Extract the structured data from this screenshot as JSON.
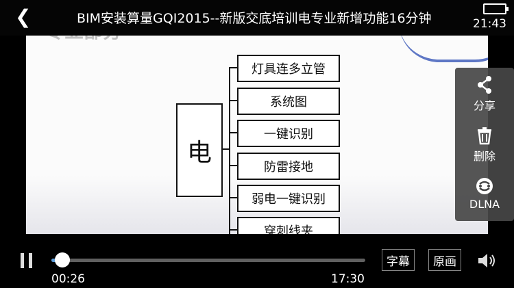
{
  "header": {
    "back_icon": "chevron-left-icon",
    "title": "BIM安装算量GQI2015--新版交底培训电专业新增功能16分钟"
  },
  "status_bar": {
    "time": "21:43",
    "battery_icon": "battery-icon"
  },
  "slide": {
    "faded_heading": "专业部分",
    "root": "电",
    "branches": [
      "灯具连多立管",
      "系统图",
      "一键识别",
      "防雷接地",
      "弱电一键识别",
      "穿刺线夹"
    ]
  },
  "side_menu": {
    "items": [
      {
        "label": "分享",
        "icon": "share-icon"
      },
      {
        "label": "删除",
        "icon": "trash-icon"
      },
      {
        "label": "DLNA",
        "icon": "dlna-icon"
      }
    ]
  },
  "player": {
    "current_time": "00:26",
    "total_time": "17:30",
    "progress": 0.025,
    "subtitle_label": "字幕",
    "quality_label": "原画",
    "play_state_icon": "pause-icon",
    "volume_icon": "volume-icon"
  }
}
